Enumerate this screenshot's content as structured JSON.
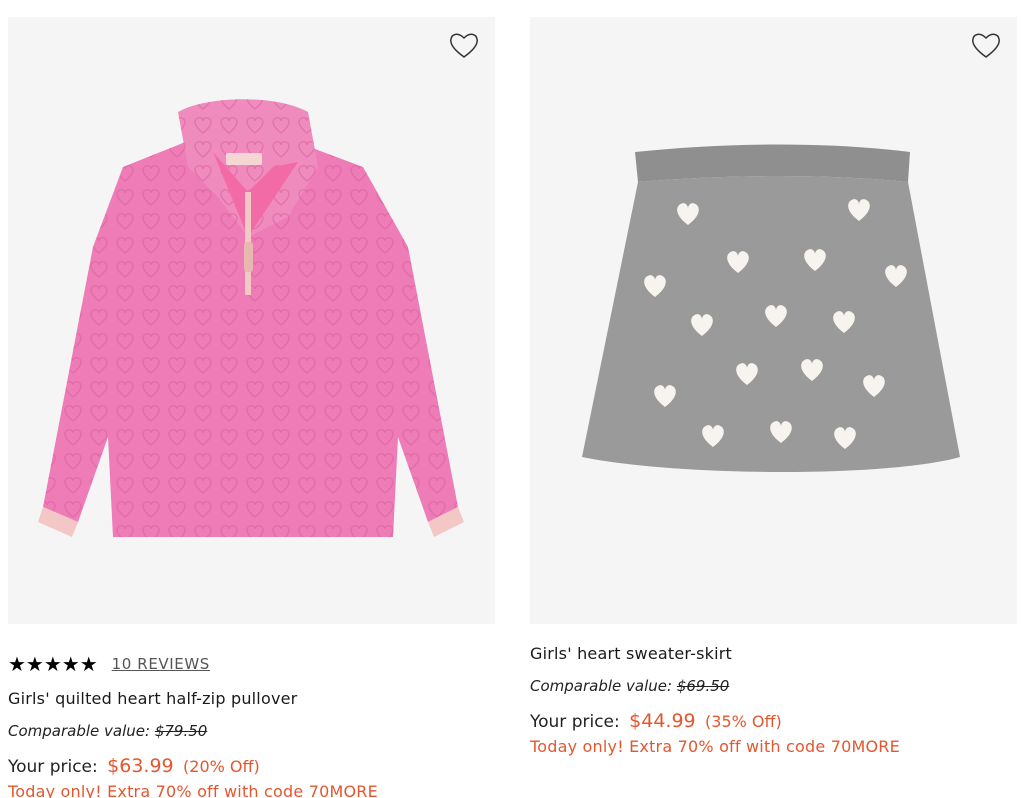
{
  "products": [
    {
      "image_alt": "pink pullover",
      "favorite_icon": "heart-outline-icon",
      "rating_stars": "★★★★★",
      "reviews_label": "10 REVIEWS",
      "name": "Girls' quilted heart half-zip pullover",
      "comparable_label": "Comparable value:",
      "comparable_value": "$79.50",
      "your_price_label": "Your price:",
      "price": "$63.99",
      "discount": "(20% Off)",
      "promo": "Today only! Extra 70% off with code 70MORE",
      "product_color": "#ee7cb6"
    },
    {
      "image_alt": "grey skirt",
      "favorite_icon": "heart-outline-icon",
      "name": "Girls' heart sweater-skirt",
      "comparable_label": "Comparable value:",
      "comparable_value": "$69.50",
      "your_price_label": "Your price:",
      "price": "$44.99",
      "discount": "(35% Off)",
      "promo": "Today only! Extra 70% off with code 70MORE",
      "product_color": "#9a9a9a"
    }
  ],
  "colors": {
    "sale": "#e4572e",
    "image_bg": "#f5f5f5"
  }
}
